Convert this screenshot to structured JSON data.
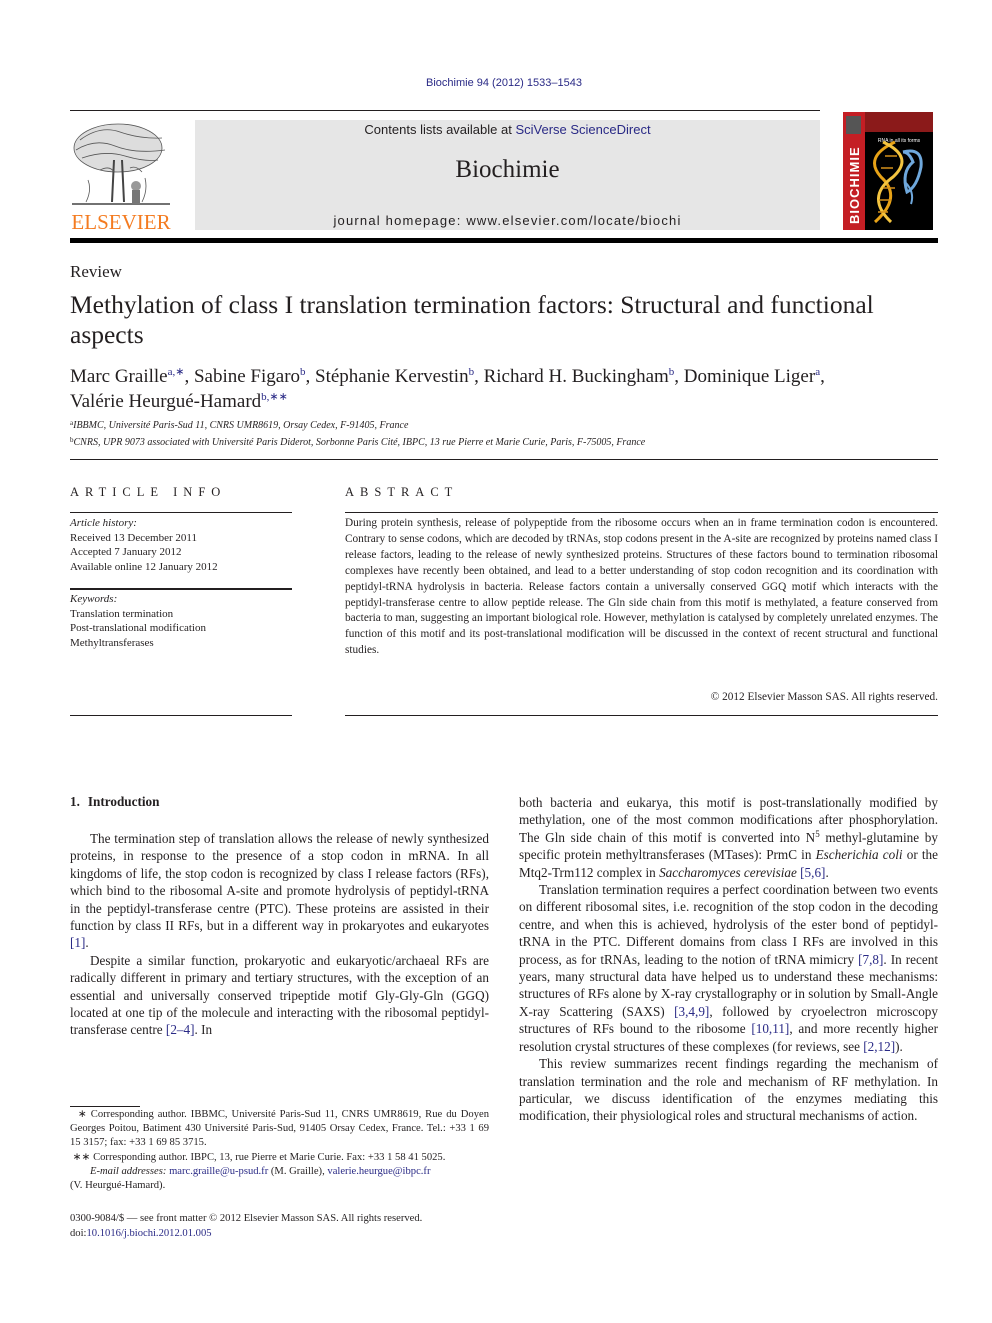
{
  "header": {
    "citation": "Biochimie 94 (2012) 1533–1543",
    "contents_prefix": "Contents lists available at ",
    "contents_link": "SciVerse ScienceDirect",
    "journal_name": "Biochimie",
    "homepage_prefix": "journal homepage: ",
    "homepage_url": "www.elsevier.com/locate/biochi",
    "publisher_logo_text": "ELSEVIER",
    "cover_spine_text": "BIOCHIMIE",
    "cover_caption": "RNA in all its forms"
  },
  "article": {
    "type": "Review",
    "title": "Methylation of class I translation termination factors: Structural and functional aspects",
    "authors": [
      {
        "name": "Marc Graille",
        "sup": "a,∗",
        "sep": ", "
      },
      {
        "name": "Sabine Figaro",
        "sup": "b",
        "sep": ", "
      },
      {
        "name": "Stéphanie Kervestin",
        "sup": "b",
        "sep": ", "
      },
      {
        "name": "Richard H. Buckingham",
        "sup": "b",
        "sep": ", "
      },
      {
        "name": "Dominique Liger",
        "sup": "a",
        "sep": ","
      },
      {
        "name": "Valérie Heurgué-Hamard",
        "sup": "b,∗∗",
        "sep": ""
      }
    ],
    "affiliations": [
      {
        "mark": "a",
        "text": "IBBMC, Université Paris-Sud 11, CNRS UMR8619, Orsay Cedex, F-91405, France"
      },
      {
        "mark": "b",
        "text": "CNRS, UPR 9073 associated with Université Paris Diderot, Sorbonne Paris Cité, IBPC, 13 rue Pierre et Marie Curie, Paris, F-75005, France"
      }
    ]
  },
  "article_info": {
    "heading": "ARTICLE INFO",
    "history_label": "Article history:",
    "history": [
      "Received 13 December 2011",
      "Accepted 7 January 2012",
      "Available online 12 January 2012"
    ],
    "keywords_label": "Keywords:",
    "keywords": [
      "Translation termination",
      "Post-translational modification",
      "Methyltransferases"
    ]
  },
  "abstract": {
    "heading": "ABSTRACT",
    "text": "During protein synthesis, release of polypeptide from the ribosome occurs when an in frame termination codon is encountered. Contrary to sense codons, which are decoded by tRNAs, stop codons present in the A-site are recognized by proteins named class I release factors, leading to the release of newly synthe­sized proteins. Structures of these factors bound to termination ribosomal complexes have recently been obtained, and lead to a better understanding of stop codon recognition and its coordination with peptidyl-tRNA hydrolysis in bacteria. Release factors contain a universally conserved GGQ motif which interacts with the peptidyl-transferase centre to allow peptide release. The Gln side chain from this motif is methylated, a feature conserved from bacteria to man, suggesting an important biological role. However, methylation is catalysed by completely unrelated enzymes. The function of this motif and its post-translational modification will be discussed in the context of recent structural and functional studies.",
    "copyright": "© 2012 Elsevier Masson SAS. All rights reserved."
  },
  "body": {
    "section_number": "1.",
    "section_title": "Introduction",
    "left": {
      "p1_text": "The termination step of translation allows the release of newly synthesized proteins, in response to the presence of a stop codon in mRNA. In all kingdoms of life, the stop codon is recognized by class I release factors (RFs), which bind to the ribosomal A-site and promote hydrolysis of peptidyl-tRNA in the peptidyl-transferase centre (PTC). These proteins are assisted in their function by class II RFs, but in a different way in prokaryotes and eukaryotes ",
      "p1_ref": "[1]",
      "p1_end": ".",
      "p2_text": "Despite a similar function, prokaryotic and eukaryotic/archaeal RFs are radically different in primary and tertiary structures, with the exception of an essential and universally conserved tripeptide motif Gly-Gly-Gln (GGQ) located at one tip of the molecule and interacting with the ribosomal peptidyl-transferase centre ",
      "p2_ref": "[2–4]",
      "p2_end": ". In"
    },
    "right": {
      "p1_a": "both bacteria and eukarya, this motif is post-translationally modi­fied by methylation, one of the most common modifications after phosphorylation. The Gln side chain of this motif is converted into N",
      "p1_sup": "5",
      "p1_b": " methyl-glutamine by specific protein methyltransferases (MTases): PrmC in ",
      "p1_em1": "Escherichia coli",
      "p1_c": " or the Mtq2-Trm112 complex in ",
      "p1_em2": "Saccharomyces cerevisiae",
      "p1_d": " ",
      "p1_ref": "[5,6]",
      "p1_end": ".",
      "p2_a": "Translation termination requires a perfect coordination between two events on different ribosomal sites, i.e. recognition of the stop codon in the decoding centre, and when this is achieved, hydrolysis of the ester bond of peptidyl-tRNA in the PTC. Different domains from class I RFs are involved in this process, as for tRNAs, leading to the notion of tRNA mimicry ",
      "p2_ref1": "[7,8]",
      "p2_b": ". In recent years, many structural data have helped us to understand these mechanisms: structures of RFs alone by X-ray crystallography or in solution by Small-Angle X-ray Scattering (SAXS) ",
      "p2_ref2": "[3,4,9]",
      "p2_c": ", followed by cryoelec­tron microscopy structures of RFs bound to the ribosome ",
      "p2_ref3": "[10,11]",
      "p2_d": ", and more recently higher resolution crystal structures of these complexes (for reviews, see ",
      "p2_ref4": "[2,12]",
      "p2_end": ").",
      "p3": "This review summarizes recent findings regarding the mecha­nism of translation termination and the role and mechanism of RF methylation. In particular, we discuss identification of the enzymes mediating this modification, their physiological roles and structural mechanisms of action."
    }
  },
  "footnotes": {
    "fn1_mark": "∗",
    "fn1_text": " Corresponding author. IBBMC, Université Paris-Sud 11, CNRS UMR8619, Rue du Doyen Georges Poitou, Batiment 430 Université Paris-Sud, 91405 Orsay Cedex, France. Tel.: +33 1 69 15 3157; fax: +33 1 69 85 3715.",
    "fn2_mark": "∗∗",
    "fn2_text": " Corresponding author. IBPC, 13, rue Pierre et Marie Curie. Fax: +33 1 58 41 5025.",
    "email_label": "E-mail addresses:",
    "email1": "marc.graille@u-psud.fr",
    "email1_who": " (M. Graille), ",
    "email2": "valerie.heurgue@ibpc.fr",
    "email2_who": "(V. Heurgué-Hamard).",
    "front_matter": "0300-9084/$ — see front matter © 2012 Elsevier Masson SAS. All rights reserved.",
    "doi_label": "doi:",
    "doi": "10.1016/j.biochi.2012.01.005"
  },
  "colors": {
    "link": "#2a2a86",
    "elsevier_orange": "#f47b20",
    "cover_red": "#c41e24",
    "header_box": "#e6e6e6"
  }
}
